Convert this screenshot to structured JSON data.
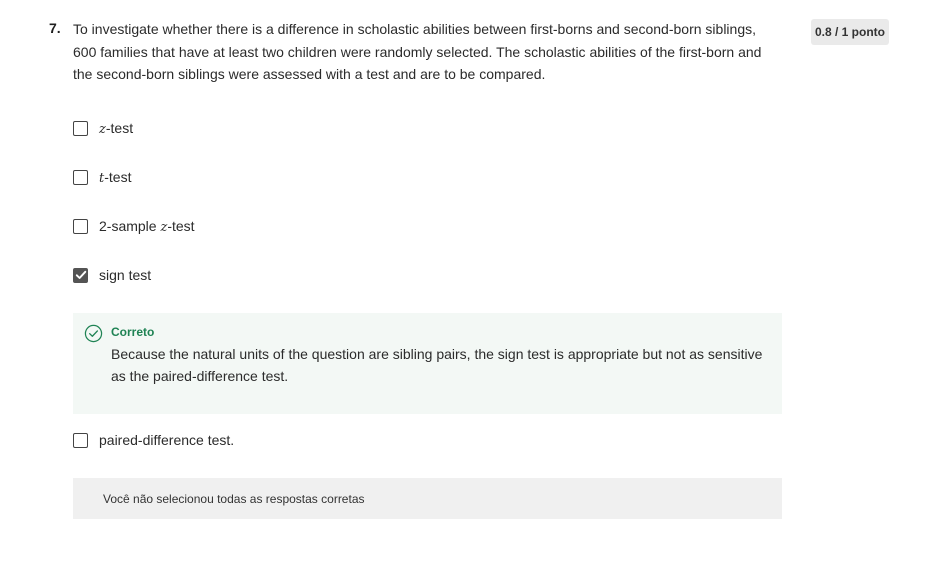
{
  "question": {
    "number": "7.",
    "text": "To investigate whether there is a difference in scholastic abilities between first-borns and second-born siblings, 600 families that have at least two children were randomly selected. The scholastic abilities of the first-born and the second-born siblings were assessed with a test and are to be compared.",
    "score": "0.8 / 1 ponto"
  },
  "options": [
    {
      "prefix": "",
      "var": "z",
      "suffix": "-test",
      "checked": false
    },
    {
      "prefix": "",
      "var": "t",
      "suffix": "-test",
      "checked": false
    },
    {
      "prefix": "2-sample ",
      "var": "z",
      "suffix": "-test",
      "checked": false
    },
    {
      "prefix": "sign test",
      "var": "",
      "suffix": "",
      "checked": true
    },
    {
      "prefix": "paired-difference test.",
      "var": "",
      "suffix": "",
      "checked": false
    }
  ],
  "feedback": {
    "title": "Correto",
    "text": "Because the natural units of the question are sibling pairs, the sign test is appropriate but not as sensitive as the paired-difference test.",
    "icon": "check-circle-icon",
    "color": "#1f8354"
  },
  "note": "Você não selecionou todas as respostas corretas"
}
